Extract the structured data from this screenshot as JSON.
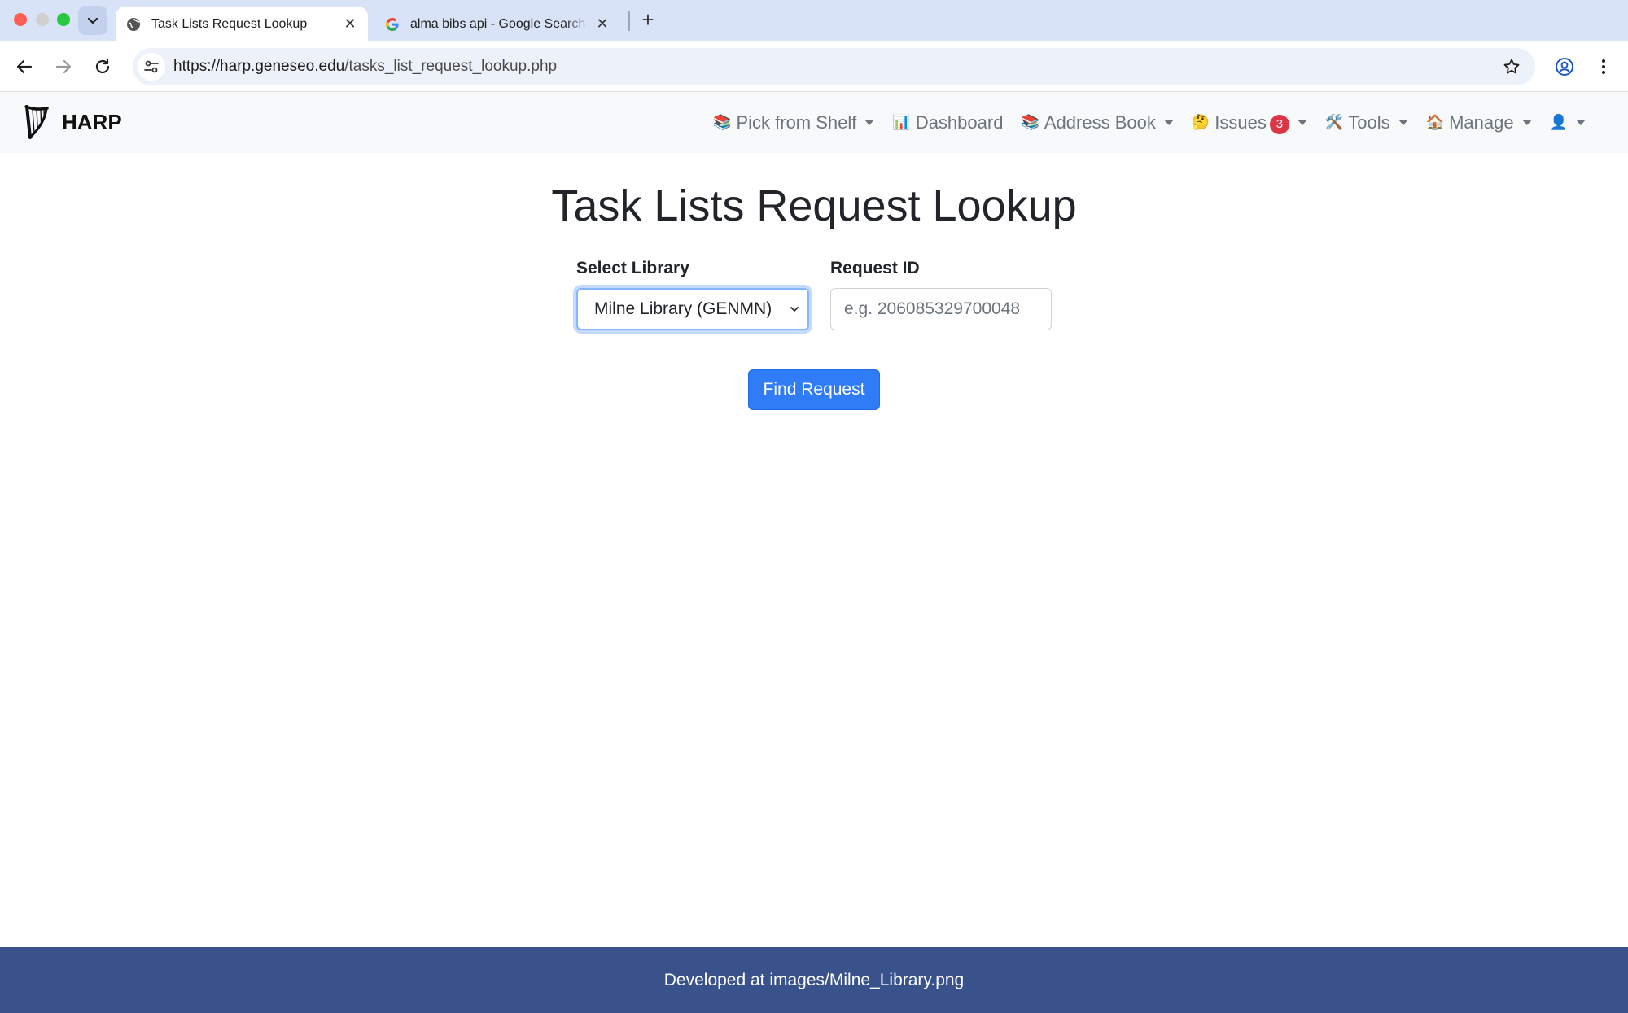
{
  "browser": {
    "tabs": [
      {
        "title": "Task Lists Request Lookup",
        "icon": "globe-icon",
        "active": true
      },
      {
        "title": "alma bibs api - Google Search",
        "icon": "google-icon",
        "active": false
      }
    ],
    "url_host": "https://harp.geneseo.edu",
    "url_path": "/tasks_list_request_lookup.php"
  },
  "navbar": {
    "brand": "HARP",
    "brand_icon": "harp-icon",
    "items": [
      {
        "emoji": "📚",
        "label": "Pick from Shelf",
        "dropdown": true
      },
      {
        "emoji": "📊",
        "label": "Dashboard",
        "dropdown": false
      },
      {
        "emoji": "📚",
        "label": "Address Book",
        "dropdown": true
      },
      {
        "emoji": "🤔",
        "label": "Issues",
        "badge": "3",
        "dropdown": true
      },
      {
        "emoji": "🛠️",
        "label": "Tools",
        "dropdown": true
      },
      {
        "emoji": "🏠",
        "label": "Manage",
        "dropdown": true
      },
      {
        "emoji": "👤",
        "label": "",
        "dropdown": true
      }
    ]
  },
  "main": {
    "title": "Task Lists Request Lookup",
    "library_label": "Select Library",
    "library_value": "Milne Library (GENMN)",
    "request_label": "Request ID",
    "request_placeholder": "e.g. 206085329700048",
    "submit_label": "Find Request"
  },
  "footer": {
    "text": "Developed at images/Milne_Library.png"
  },
  "colors": {
    "primary": "#2f7cf6",
    "footer": "#3a528c",
    "badge": "#dc3545",
    "tabstrip": "#d9e3f7"
  }
}
